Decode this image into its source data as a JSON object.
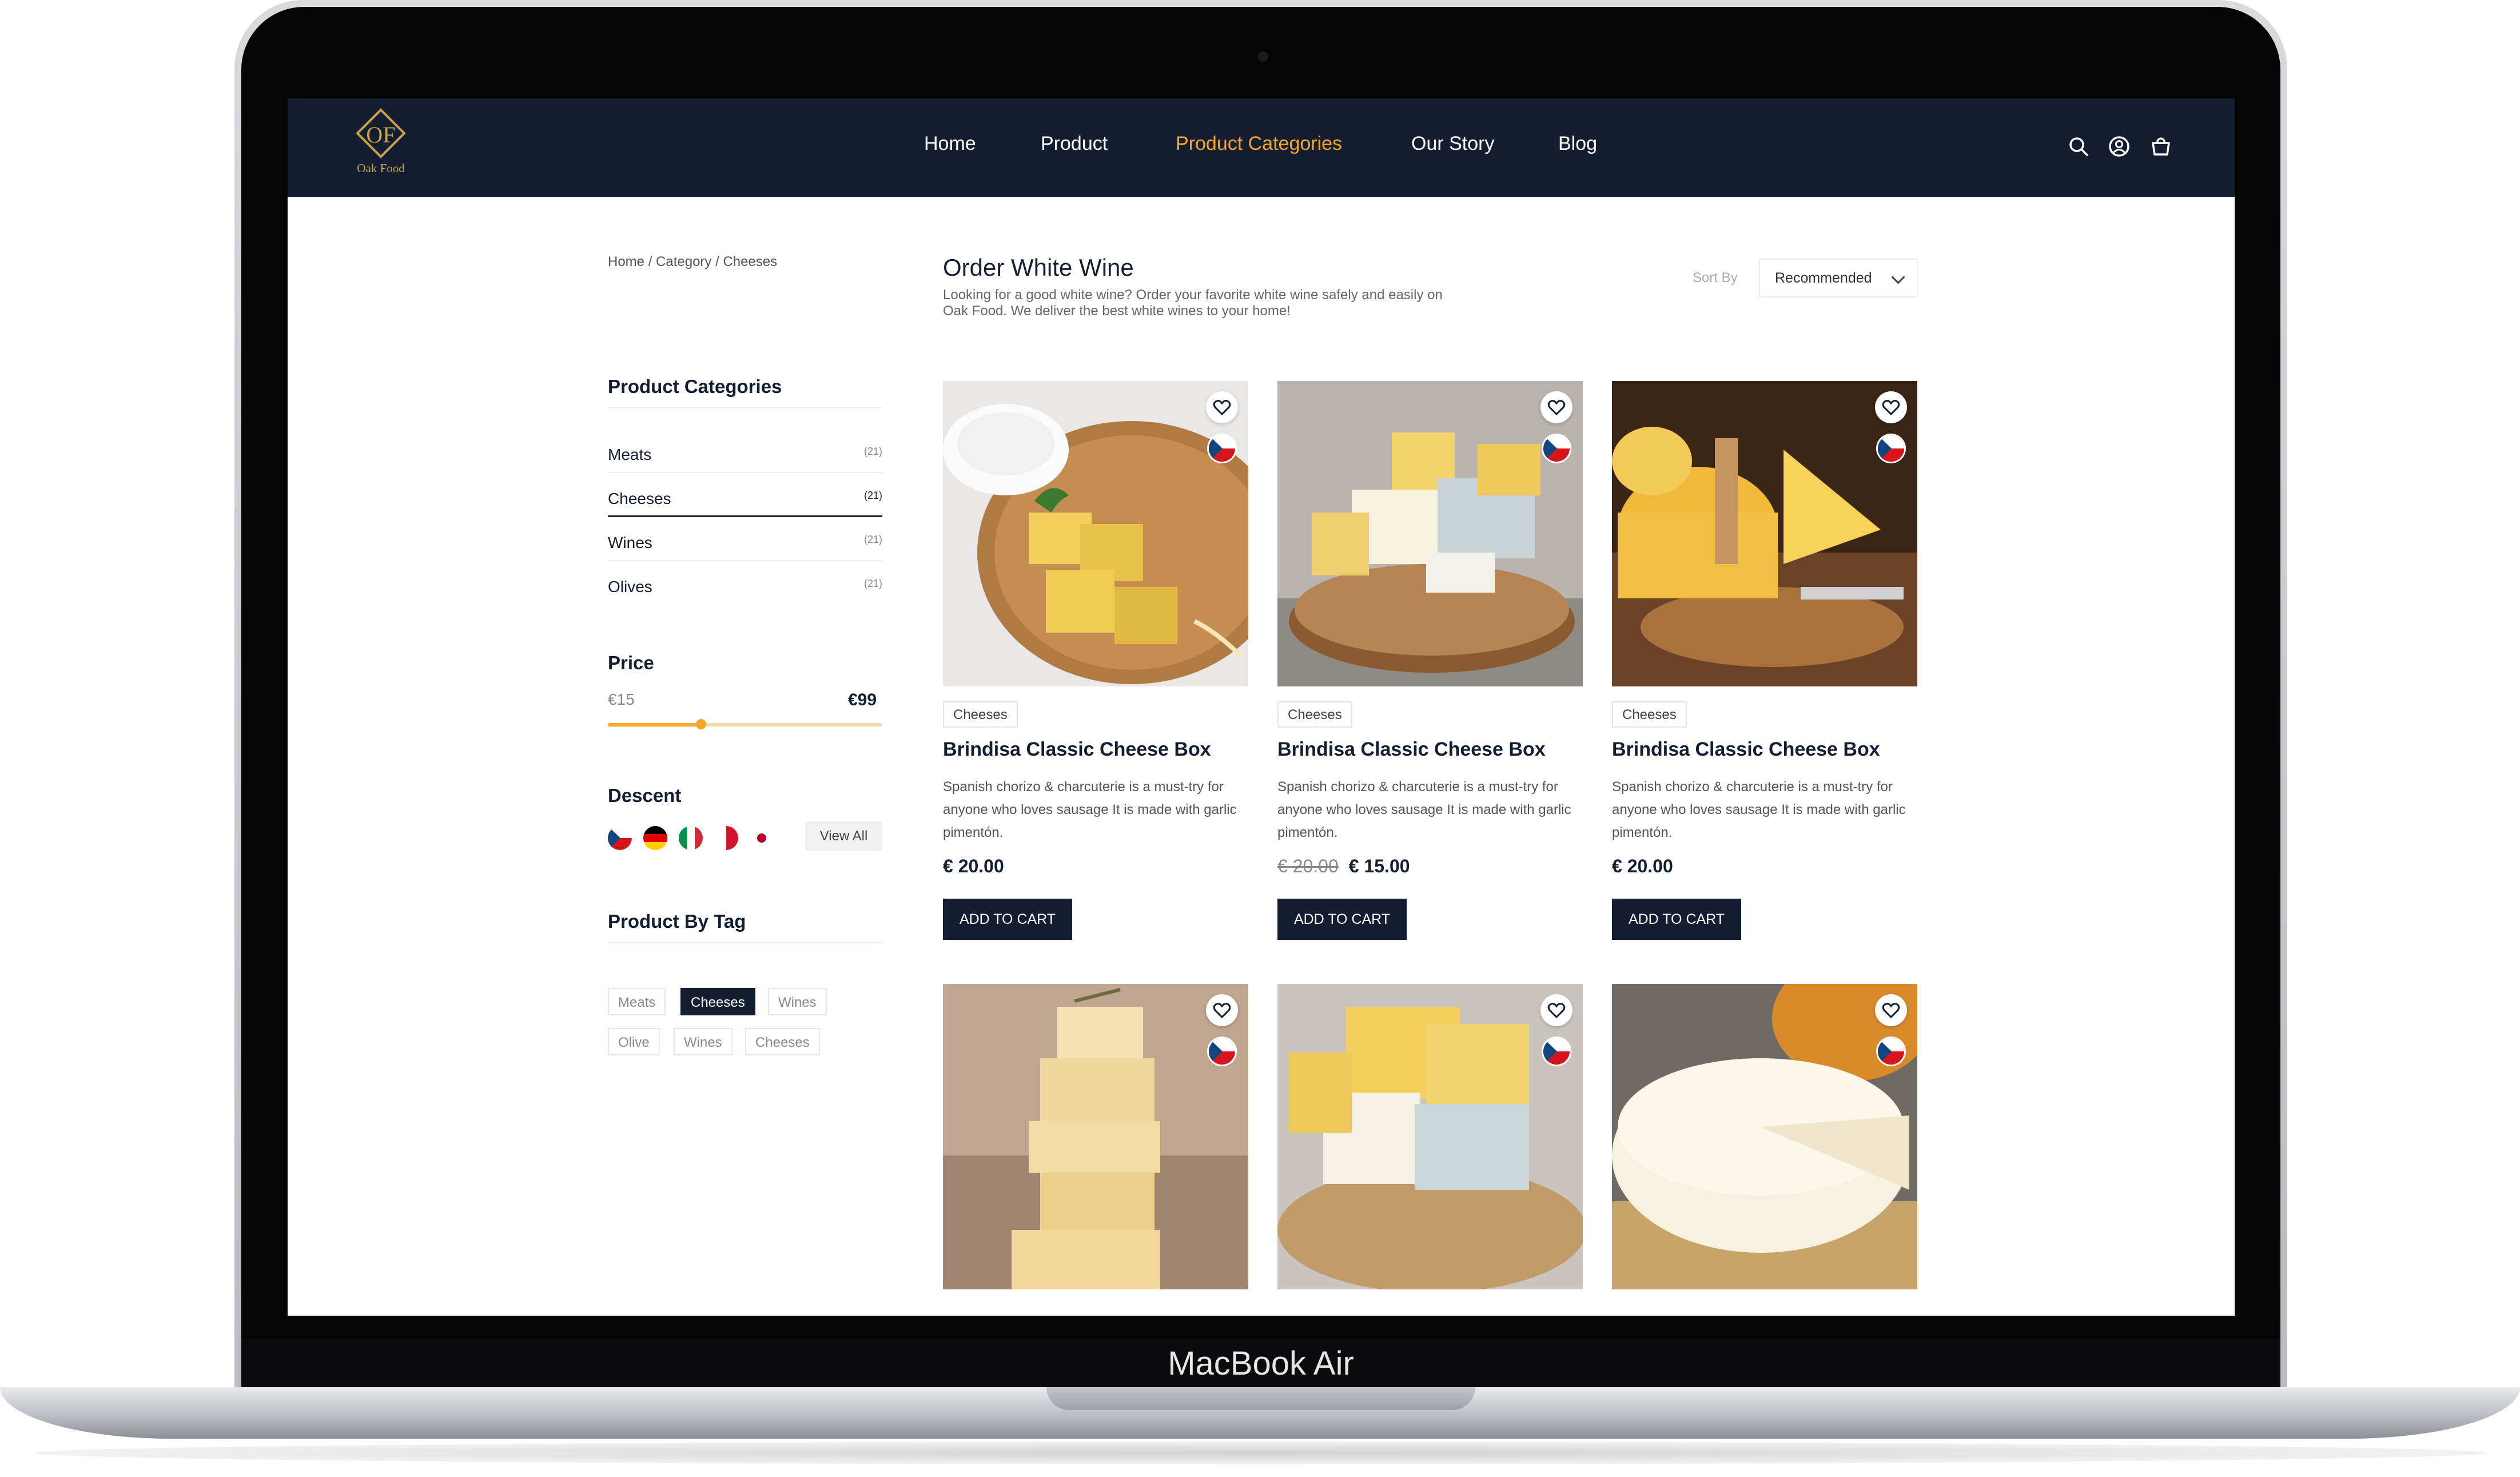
{
  "device": {
    "model_label": "MacBook Air"
  },
  "brand": {
    "logo_letters": "OF",
    "name": "Oak Food"
  },
  "nav": {
    "items": [
      {
        "label": "Home"
      },
      {
        "label": "Product"
      },
      {
        "label": "Product Categories"
      },
      {
        "label": "Our Story"
      },
      {
        "label": "Blog"
      }
    ],
    "active": "Product Categories",
    "icons": [
      "search-icon",
      "user-icon",
      "cart-icon"
    ]
  },
  "breadcrumb": "Home / Category / Cheeses",
  "sidebar": {
    "categories_title": "Product Categories",
    "categories": [
      {
        "name": "Meats",
        "count": "(21)"
      },
      {
        "name": "Cheeses",
        "count": "(21)"
      },
      {
        "name": "Wines",
        "count": "(21)"
      },
      {
        "name": "Olives",
        "count": "(21)"
      }
    ],
    "selected_category": "Cheeses",
    "price_title": "Price",
    "price_min": "€15",
    "price_max": "€99",
    "price_slider_fraction": 0.34,
    "descent_title": "Descent",
    "descent_flags": [
      "czech-flag-icon",
      "germany-flag-icon",
      "italy-flag-icon",
      "malta-flag-icon",
      "japan-flag-icon"
    ],
    "view_all": "View All",
    "tags_title": "Product By Tag",
    "tags": [
      "Meats",
      "Cheeses",
      "Wines",
      "Olive",
      "Wines",
      "Cheeses"
    ],
    "active_tag": "Cheeses"
  },
  "main": {
    "title": "Order White Wine",
    "description": "Looking for a good white wine? Order your favorite white wine safely and easily on Oak Food. We deliver the best white wines to your home!",
    "sort_label": "Sort By",
    "sort_value": "Recommended",
    "products": [
      {
        "tag": "Cheeses",
        "name": "Brindisa Classic Cheese Box",
        "description": "Spanish chorizo & charcuterie is a must-try for anyone who loves sausage It is made with garlic pimentón.",
        "old_price": "",
        "price": "€ 20.00",
        "button": "ADD TO CART"
      },
      {
        "tag": "Cheeses",
        "name": "Brindisa Classic Cheese Box",
        "description": "Spanish chorizo & charcuterie is a must-try for anyone who loves sausage It is made with garlic pimentón.",
        "old_price": "€ 20.00",
        "price": "€ 15.00",
        "button": "ADD TO CART"
      },
      {
        "tag": "Cheeses",
        "name": "Brindisa Classic Cheese Box",
        "description": "Spanish chorizo & charcuterie is a must-try for anyone who loves sausage It is made with garlic pimentón.",
        "old_price": "",
        "price": "€ 20.00",
        "button": "ADD TO CART"
      }
    ],
    "colors": {
      "navy": "#131e32",
      "accent": "#f4a62a",
      "gold": "#c9a14a"
    }
  }
}
